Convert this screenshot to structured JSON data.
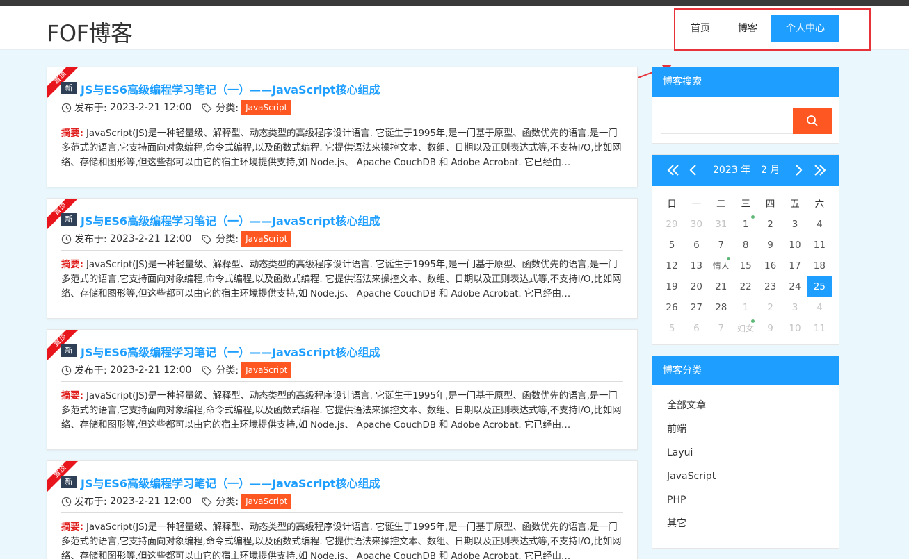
{
  "header": {
    "logo": "FOF博客",
    "nav": {
      "home": "首页",
      "blog": "博客",
      "center": "个人中心"
    }
  },
  "colors": {
    "accent": "#1e9fff",
    "tag": "#ff5722",
    "highlight": "#e8323a",
    "ribbon": "#e8161c"
  },
  "posts": [
    {
      "ribbon": "置顶",
      "badge": "新",
      "title": "JS与ES6高级编程学习笔记（一）——JavaScript核心组成",
      "date_label": "发布于:",
      "date": "2023-2-21 12:00",
      "category_label": "分类:",
      "category": "JavaScript",
      "summary_label": "摘要:",
      "summary": "JavaScript(JS)是一种轻量级、解释型、动态类型的高级程序设计语言. 它诞生于1995年,是一门基于原型、函数优先的语言,是一门多范式的语言,它支持面向对象编程,命令式编程,以及函数式编程. 它提供语法来操控文本、数组、日期以及正则表达式等,不支持I/O,比如网络、存储和图形等,但这些都可以由它的宿主环境提供支持,如 Node.js、 Apache CouchDB 和 Adobe Acrobat. 它已经由…"
    },
    {
      "ribbon": "置顶",
      "badge": "新",
      "title": "JS与ES6高级编程学习笔记（一）——JavaScript核心组成",
      "date_label": "发布于:",
      "date": "2023-2-21 12:00",
      "category_label": "分类:",
      "category": "JavaScript",
      "summary_label": "摘要:",
      "summary": "JavaScript(JS)是一种轻量级、解释型、动态类型的高级程序设计语言. 它诞生于1995年,是一门基于原型、函数优先的语言,是一门多范式的语言,它支持面向对象编程,命令式编程,以及函数式编程. 它提供语法来操控文本、数组、日期以及正则表达式等,不支持I/O,比如网络、存储和图形等,但这些都可以由它的宿主环境提供支持,如 Node.js、 Apache CouchDB 和 Adobe Acrobat. 它已经由…"
    },
    {
      "ribbon": "置顶",
      "badge": "新",
      "title": "JS与ES6高级编程学习笔记（一）——JavaScript核心组成",
      "date_label": "发布于:",
      "date": "2023-2-21 12:00",
      "category_label": "分类:",
      "category": "JavaScript",
      "summary_label": "摘要:",
      "summary": "JavaScript(JS)是一种轻量级、解释型、动态类型的高级程序设计语言. 它诞生于1995年,是一门基于原型、函数优先的语言,是一门多范式的语言,它支持面向对象编程,命令式编程,以及函数式编程. 它提供语法来操控文本、数组、日期以及正则表达式等,不支持I/O,比如网络、存储和图形等,但这些都可以由它的宿主环境提供支持,如 Node.js、 Apache CouchDB 和 Adobe Acrobat. 它已经由…"
    },
    {
      "ribbon": "置顶",
      "badge": "新",
      "title": "JS与ES6高级编程学习笔记（一）——JavaScript核心组成",
      "date_label": "发布于:",
      "date": "2023-2-21 12:00",
      "category_label": "分类:",
      "category": "JavaScript",
      "summary_label": "摘要:",
      "summary": "JavaScript(JS)是一种轻量级、解释型、动态类型的高级程序设计语言. 它诞生于1995年,是一门基于原型、函数优先的语言,是一门多范式的语言,它支持面向对象编程,命令式编程,以及函数式编程. 它提供语法来操控文本、数组、日期以及正则表达式等,不支持I/O,比如网络、存储和图形等,但这些都可以由它的宿主环境提供支持,如 Node.js、 Apache CouchDB 和 Adobe Acrobat. 它已经由…"
    }
  ],
  "search": {
    "title": "博客搜索",
    "placeholder": ""
  },
  "calendar": {
    "year": "2023 年",
    "month": "2 月",
    "weekdays": [
      "日",
      "一",
      "二",
      "三",
      "四",
      "五",
      "六"
    ],
    "days": [
      {
        "t": "29",
        "m": true
      },
      {
        "t": "30",
        "m": true
      },
      {
        "t": "31",
        "m": true
      },
      {
        "t": "1",
        "mark": true
      },
      {
        "t": "2"
      },
      {
        "t": "3"
      },
      {
        "t": "4"
      },
      {
        "t": "5"
      },
      {
        "t": "6"
      },
      {
        "t": "7"
      },
      {
        "t": "8"
      },
      {
        "t": "9"
      },
      {
        "t": "10"
      },
      {
        "t": "11"
      },
      {
        "t": "12"
      },
      {
        "t": "13"
      },
      {
        "t": "情人",
        "festival": true,
        "mark": true
      },
      {
        "t": "15"
      },
      {
        "t": "16"
      },
      {
        "t": "17"
      },
      {
        "t": "18"
      },
      {
        "t": "19"
      },
      {
        "t": "20"
      },
      {
        "t": "21"
      },
      {
        "t": "22"
      },
      {
        "t": "23"
      },
      {
        "t": "24"
      },
      {
        "t": "25",
        "today": true
      },
      {
        "t": "26"
      },
      {
        "t": "27"
      },
      {
        "t": "28"
      },
      {
        "t": "1",
        "m": true
      },
      {
        "t": "2",
        "m": true
      },
      {
        "t": "3",
        "m": true
      },
      {
        "t": "4",
        "m": true
      },
      {
        "t": "5",
        "m": true
      },
      {
        "t": "6",
        "m": true
      },
      {
        "t": "7",
        "m": true
      },
      {
        "t": "妇女",
        "m": true,
        "festival": true,
        "mark": true
      },
      {
        "t": "9",
        "m": true
      },
      {
        "t": "10",
        "m": true
      },
      {
        "t": "11",
        "m": true
      }
    ]
  },
  "categories": {
    "title": "博客分类",
    "items": [
      "全部文章",
      "前端",
      "Layui",
      "JavaScript",
      "PHP",
      "其它"
    ]
  }
}
